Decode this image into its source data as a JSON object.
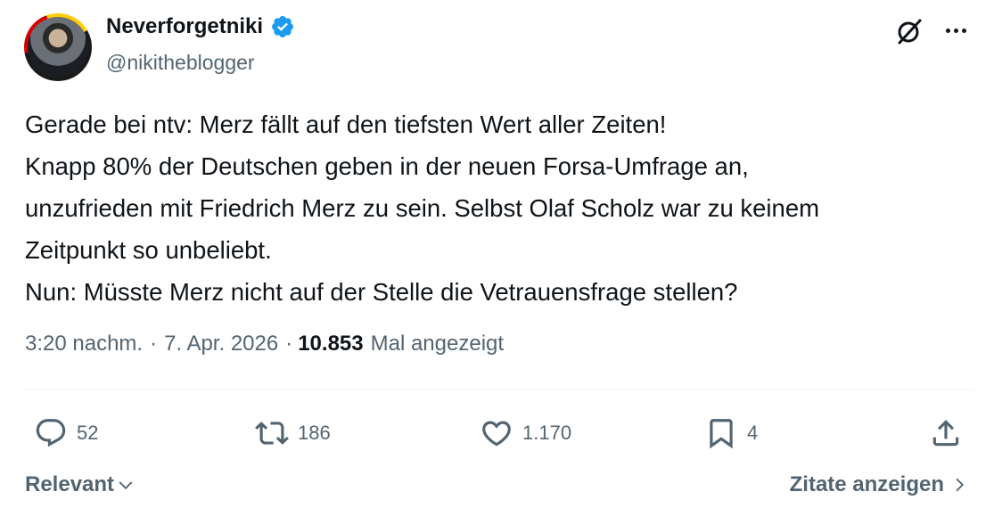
{
  "author": {
    "display_name": "Neverforgetniki",
    "handle": "@nikitheblogger",
    "verified": true
  },
  "tweet": {
    "lines": [
      "Gerade bei ntv: Merz fällt auf den tiefsten Wert aller Zeiten!",
      "Knapp 80% der Deutschen geben in der neuen Forsa-Umfrage an,",
      "unzufrieden mit Friedrich Merz zu sein. Selbst Olaf Scholz war zu keinem",
      "Zeitpunkt so unbeliebt.",
      "Nun: Müsste Merz nicht auf der Stelle die Vetrauensfrage stellen?"
    ]
  },
  "meta": {
    "time": "3:20 nachm.",
    "separator": "·",
    "date": "7. Apr. 2026",
    "views": "10.853",
    "views_label": "Mal angezeigt"
  },
  "actions": {
    "replies": "52",
    "reposts": "186",
    "likes": "1.170",
    "bookmarks": "4"
  },
  "footer": {
    "sort_label": "Relevant",
    "quotes_label": "Zitate anzeigen"
  },
  "colors": {
    "text": "#0f1419",
    "secondary": "#536471",
    "verified": "#1d9bf0",
    "divider": "#eff3f4"
  },
  "icons": [
    "verified-badge-icon",
    "grok-icon",
    "more-icon",
    "reply-icon",
    "repost-icon",
    "like-icon",
    "bookmark-icon",
    "share-icon",
    "chevron-down-icon",
    "chevron-right-icon"
  ]
}
